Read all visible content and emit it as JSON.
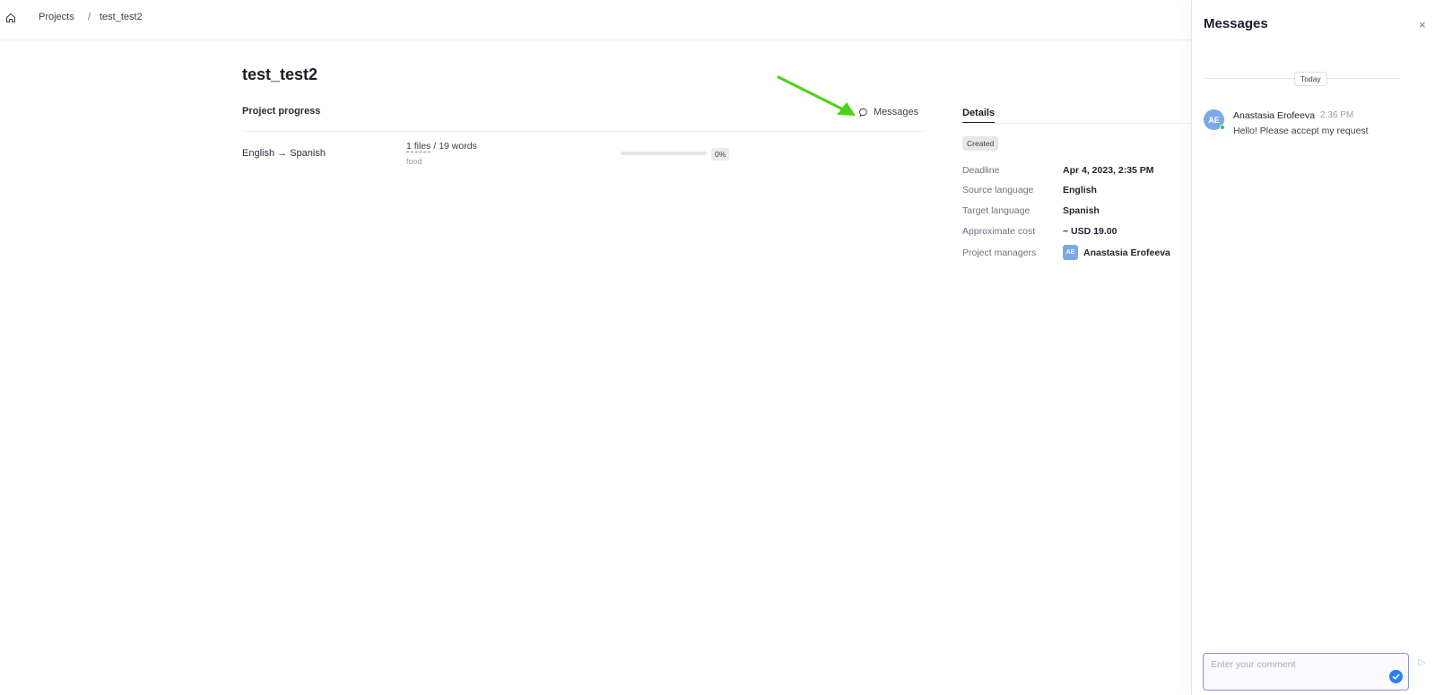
{
  "breadcrumb": {
    "home_icon": "home-icon",
    "items": [
      "Projects",
      "test_test2"
    ],
    "separator": "/"
  },
  "project": {
    "title": "test_test2",
    "section_label": "Project progress",
    "messages_button": "Messages",
    "row": {
      "language_pair": "English → Spanish",
      "files": "1 files",
      "words": " / 19 words",
      "subject": "food",
      "progress_percent": "0%",
      "progress_value": 0
    }
  },
  "details": {
    "tab_label": "Details",
    "status": "Created",
    "rows": [
      {
        "label": "Deadline",
        "value": "Apr 4, 2023, 2:35 PM"
      },
      {
        "label": "Source language",
        "value": "English"
      },
      {
        "label": "Target language",
        "value": "Spanish"
      },
      {
        "label": "Approximate cost",
        "value": "~ USD 19.00"
      },
      {
        "label": "Project managers",
        "value": "Anastasia Erofeeva",
        "avatar_initials": "AE"
      }
    ]
  },
  "messages_panel": {
    "title": "Messages",
    "close_icon": "×",
    "date_divider": "Today",
    "messages": [
      {
        "avatar_initials": "AE",
        "author": "Anastasia Erofeeva",
        "time": "2:36 PM",
        "text": "Hello! Please accept my request",
        "online": true
      }
    ],
    "comment_placeholder": "Enter your comment",
    "send_icon": "▷"
  },
  "colors": {
    "accent": "#2d7ff9",
    "arrow": "#4cd31a",
    "avatar": "#7aa9e8",
    "online": "#22c55e",
    "comment_border": "#8a8fd6"
  }
}
